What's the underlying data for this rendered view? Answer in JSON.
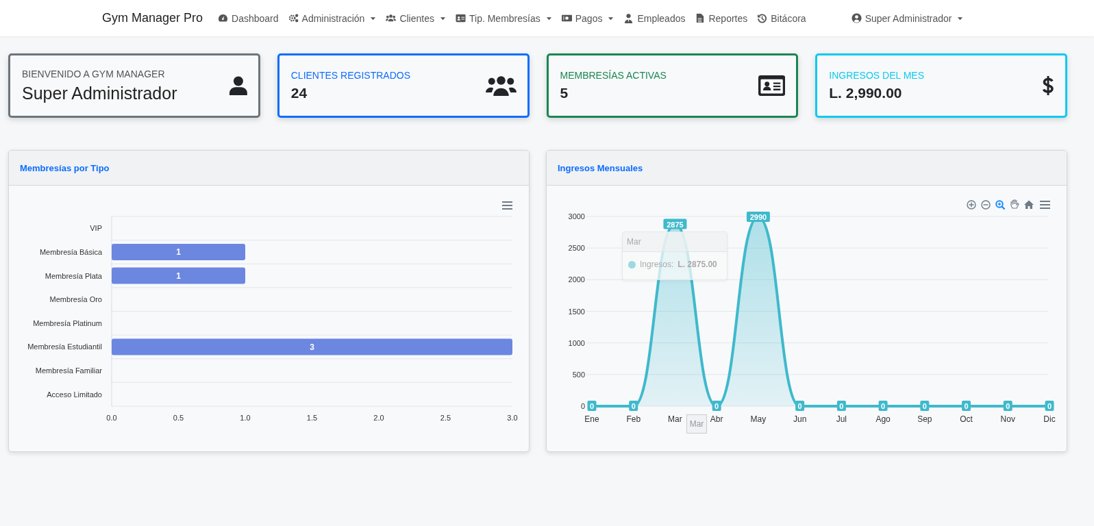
{
  "navbar": {
    "brand": "Gym Manager Pro",
    "items": [
      {
        "label": "Dashboard",
        "dropdown": false
      },
      {
        "label": "Administración",
        "dropdown": true
      },
      {
        "label": "Clientes",
        "dropdown": true
      },
      {
        "label": "Tip. Membresías",
        "dropdown": true
      },
      {
        "label": "Pagos",
        "dropdown": true
      },
      {
        "label": "Empleados",
        "dropdown": false
      },
      {
        "label": "Reportes",
        "dropdown": false
      },
      {
        "label": "Bitácora",
        "dropdown": false
      }
    ],
    "user": {
      "label": "Super Administrador",
      "dropdown": true
    }
  },
  "cards": [
    {
      "kind": "welcome",
      "title": "BIENVENIDO A GYM MANAGER",
      "value": "Super Administrador",
      "color": "#6c757d"
    },
    {
      "kind": "stat",
      "title": "CLIENTES REGISTRADOS",
      "value": "24",
      "color": "#0d6efd"
    },
    {
      "kind": "stat",
      "title": "MEMBRESÍAS ACTIVAS",
      "value": "5",
      "color": "#198754"
    },
    {
      "kind": "stat",
      "title": "INGRESOS DEL MES",
      "value": "L. 2,990.00",
      "color": "#0dcaf0"
    }
  ],
  "panels": [
    {
      "title": "Membresías por Tipo",
      "chart_data": {
        "type": "bar",
        "orientation": "horizontal",
        "categories": [
          "VIP",
          "Membresía Básica",
          "Membresía Plata",
          "Membresía Oro",
          "Membresía Platinum",
          "Membresía Estudiantil",
          "Membresía Familiar",
          "Acceso Limitado"
        ],
        "series": [
          {
            "color": "#6b87e0",
            "values": [
              0,
              1,
              1,
              0,
              0,
              3,
              0,
              0
            ]
          }
        ],
        "xlim": [
          0,
          3
        ],
        "xticks": [
          {
            "value": 0,
            "label": "0.0"
          },
          {
            "value": 0.5,
            "label": "0.5"
          },
          {
            "value": 1,
            "label": "1.0"
          },
          {
            "value": 1.5,
            "label": "1.5"
          },
          {
            "value": 2,
            "label": "2.0"
          },
          {
            "value": 2.5,
            "label": "2.5"
          },
          {
            "value": 3,
            "label": "3.0"
          }
        ],
        "grid": true,
        "value_labels": [
          null,
          "1",
          "1",
          null,
          null,
          "3",
          null,
          null
        ]
      }
    },
    {
      "title": "Ingresos Mensuales",
      "chart_data": {
        "type": "area",
        "categories": [
          "Ene",
          "Feb",
          "Mar",
          "Abr",
          "May",
          "Jun",
          "Jul",
          "Ago",
          "Sep",
          "Oct",
          "Nov",
          "Dic"
        ],
        "series": [
          {
            "color": "#3fb9cc",
            "values": [
              0,
              0,
              2875,
              0,
              2990,
              0,
              0,
              0,
              0,
              0,
              0,
              0
            ]
          }
        ],
        "ylim": [
          0,
          3000
        ],
        "yticks": [
          0,
          500,
          1000,
          1500,
          2000,
          2500,
          3000
        ],
        "grid": true,
        "data_labels": true
      },
      "tooltip": {
        "title": "Mar",
        "label": "Ingresos:",
        "value": "L. 2875.00"
      },
      "axis_tooltip": "Mar"
    }
  ]
}
